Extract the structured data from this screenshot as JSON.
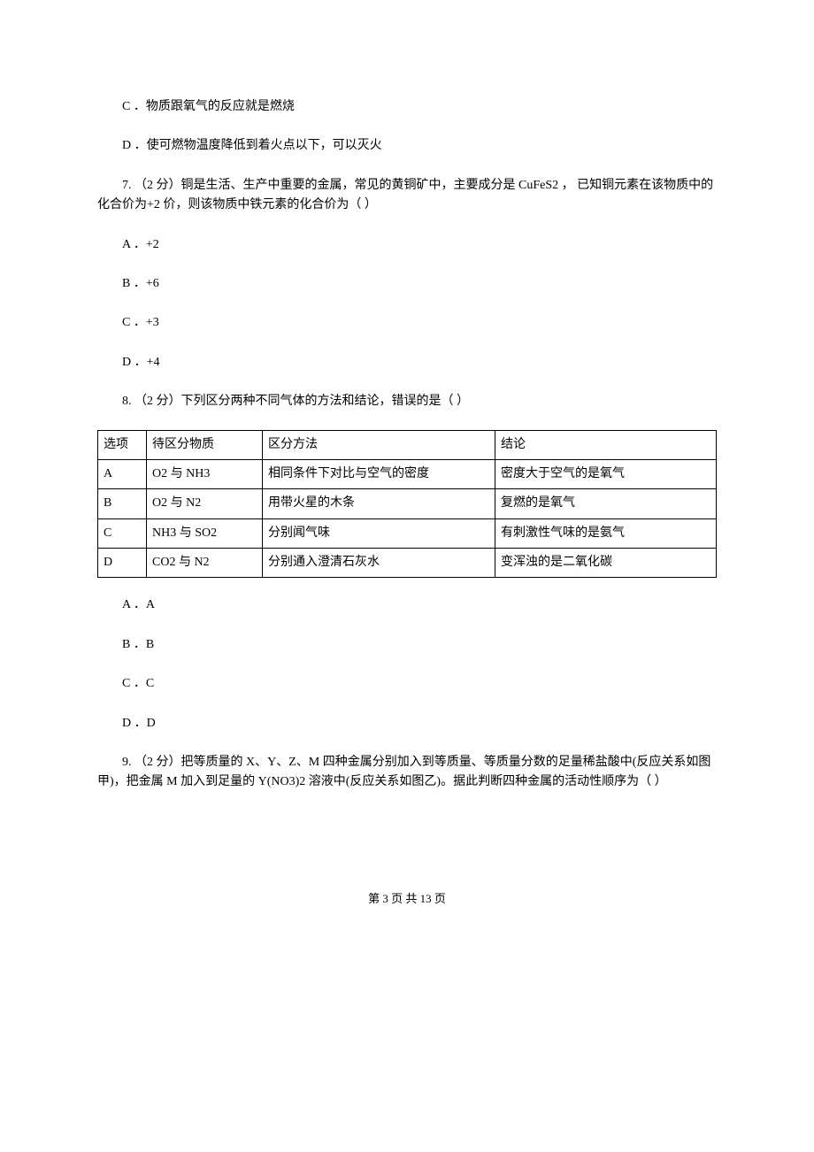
{
  "q6": {
    "optC": "C ．物质跟氧气的反应就是燃烧",
    "optD": "D ．使可燃物温度降低到着火点以下，可以灭火"
  },
  "q7": {
    "stem": "7. （2 分）铜是生活、生产中重要的金属，常见的黄铜矿中，主要成分是 CuFeS2 ， 已知铜元素在该物质中的化合价为+2 价，则该物质中铁元素的化合价为（     ）",
    "optA": "A ．+2",
    "optB": "B ．+6",
    "optC": "C ．+3",
    "optD": "D ．+4"
  },
  "q8": {
    "stem": "8. （2 分）下列区分两种不同气体的方法和结论，错误的是（     ）",
    "headers": [
      "选项",
      "待区分物质",
      "区分方法",
      "结论"
    ],
    "rows": [
      {
        "opt": "A",
        "subst": "O2 与 NH3",
        "method": "相同条件下对比与空气的密度",
        "concl": "密度大于空气的是氧气"
      },
      {
        "opt": "B",
        "subst": "O2 与 N2",
        "method": "用带火星的木条",
        "concl": "复燃的是氧气"
      },
      {
        "opt": "C",
        "subst": "NH3 与 SO2",
        "method": "分别闻气味",
        "concl": "有刺激性气味的是氨气"
      },
      {
        "opt": "D",
        "subst": "CO2 与 N2",
        "method": "分别通入澄清石灰水",
        "concl": "变浑浊的是二氧化碳"
      }
    ],
    "optA": "A ．A",
    "optB": "B ．B",
    "optC": "C ．C",
    "optD": "D ．D"
  },
  "q9": {
    "stem": "9. （2 分）把等质量的 X、Y、Z、M 四种金属分别加入到等质量、等质量分数的足量稀盐酸中(反应关系如图甲)，把金属 M 加入到足量的 Y(NO3)2 溶液中(反应关系如图乙)。据此判断四种金属的活动性顺序为（     ）"
  },
  "footer": "第 3 页 共 13 页"
}
